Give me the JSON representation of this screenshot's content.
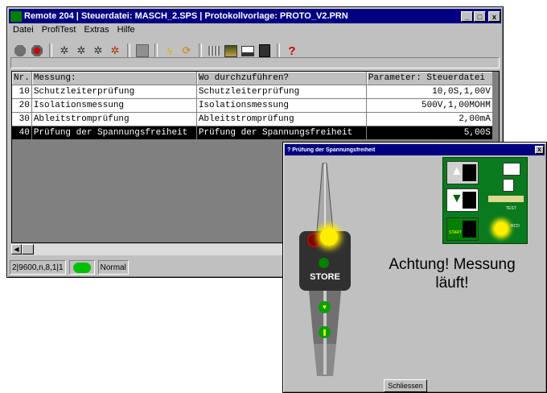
{
  "main_window": {
    "title": "Remote 204 | Steuerdatei: MASCH_2.SPS | Protokollvorlage: PROTO_V2.PRN",
    "controls": {
      "minimize": "_",
      "maximize": "□",
      "close": "x"
    },
    "menu": [
      "Datei",
      "ProfiTest",
      "Extras",
      "Hilfe"
    ],
    "toolbar_icons": [
      "stop-icon",
      "record-icon",
      "gear-icon",
      "gear-icon",
      "gear-wrench-icon",
      "gear-multicolor-icon",
      "gray-square-icon",
      "lightning-icon",
      "refresh-icon",
      "grid-icon",
      "image-icon",
      "print-icon",
      "calculator-icon",
      "help-icon"
    ],
    "table": {
      "headers": [
        "Nr.",
        "Messung:",
        "Wo durchzuführen?",
        "Parameter: Steuerdatei"
      ],
      "rows": [
        {
          "nr": "10",
          "messung": "Schutzleiterprüfung",
          "wo": "Schutzleiterprüfung",
          "param": "10,0S,1,00V"
        },
        {
          "nr": "20",
          "messung": "Isolationsmessung",
          "wo": "Isolationsmessung",
          "param": "500V,1,00MOHM"
        },
        {
          "nr": "30",
          "messung": "Ableitstromprüfung",
          "wo": "Ableitstromprüfung",
          "param": "2,00mA"
        },
        {
          "nr": "40",
          "messung": "Prüfung der Spannungsfreiheit",
          "wo": "Prüfung der Spannungsfreiheit",
          "param": "5,00S"
        }
      ],
      "selected_row": 3
    },
    "status": {
      "port": "2|9600,n,8,1|1",
      "mode": "Normal",
      "led_color": "#00c000"
    }
  },
  "dialog": {
    "title": "?  Prüfung der Spannungsfreiheit",
    "close_symbol": "x",
    "message": "Achtung! Messung läuft!",
    "close_button": "Schliessen",
    "probe_label": "STORE",
    "panel_labels": {
      "test": "TEST",
      "start": "START",
      "rcd": "RCD"
    }
  },
  "colors": {
    "titlebar": "#000080",
    "selection": "#000000",
    "panel_green": "#0a7a1e",
    "led_green": "#00c000",
    "warning_yellow": "#ffee00",
    "help_red": "#d00000"
  }
}
